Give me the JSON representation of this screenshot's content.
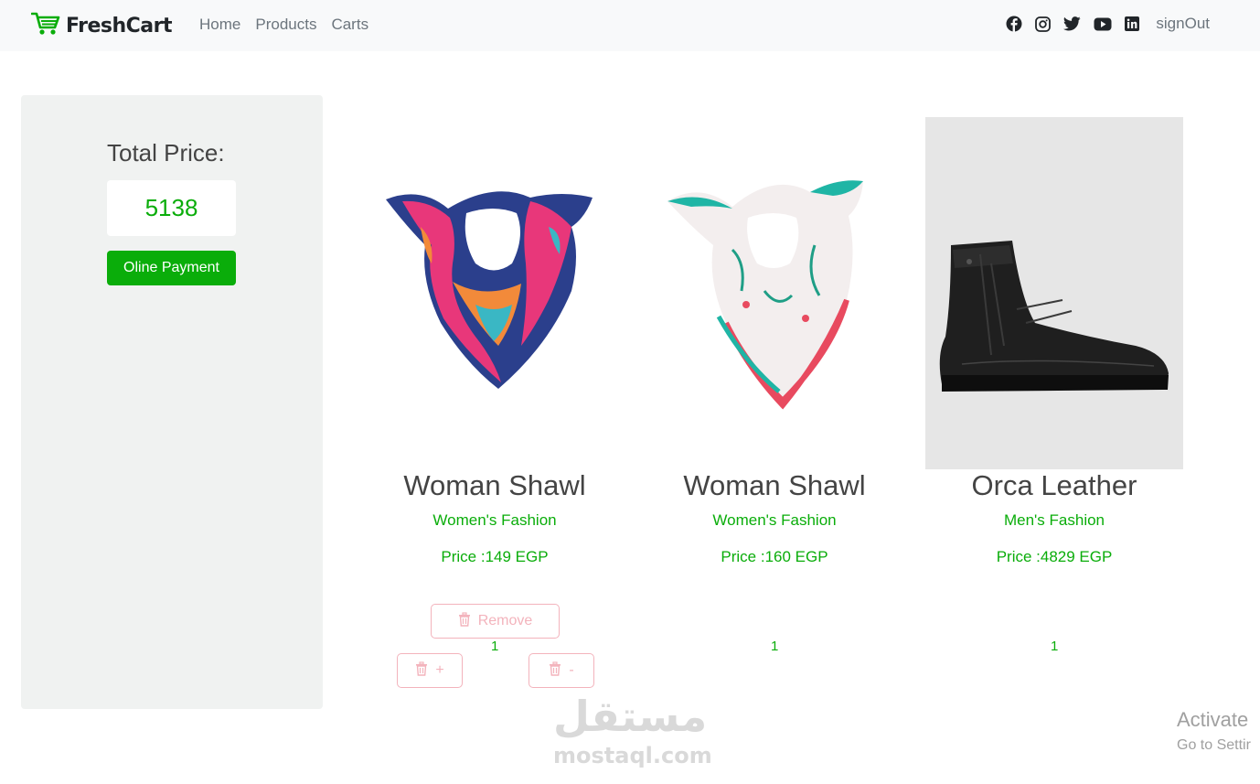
{
  "nav": {
    "brand": "FreshCart",
    "links": [
      "Home",
      "Products",
      "Carts"
    ],
    "signout": "signOut",
    "social_icons": [
      "facebook-icon",
      "instagram-icon",
      "twitter-icon",
      "youtube-icon",
      "linkedin-icon"
    ]
  },
  "summary": {
    "total_label": "Total Price:",
    "total_value": "5138",
    "payment_button": "Oline Payment"
  },
  "products": [
    {
      "title": "Woman Shawl",
      "category": "Women's Fashion",
      "price": "Price :149 EGP",
      "quantity": "1"
    },
    {
      "title": "Woman Shawl",
      "category": "Women's Fashion",
      "price": "Price :160 EGP",
      "quantity": "1"
    },
    {
      "title": "Orca Leather",
      "category": "Men's Fashion",
      "price": "Price :4829 EGP",
      "quantity": "1"
    }
  ],
  "actions": {
    "remove_label": "Remove",
    "increase_label": "+",
    "decrease_label": "-"
  },
  "watermark": {
    "arabic": "مستقل",
    "latin": "mostaql.com"
  },
  "os_notice": {
    "line1": "Activate",
    "line2": "Go to Settir"
  },
  "colors": {
    "accent": "#0aad0a",
    "danger_outline": "#f3b3bc",
    "panel_bg": "#f0f2f1",
    "navbar_bg": "#f8f9fa"
  }
}
